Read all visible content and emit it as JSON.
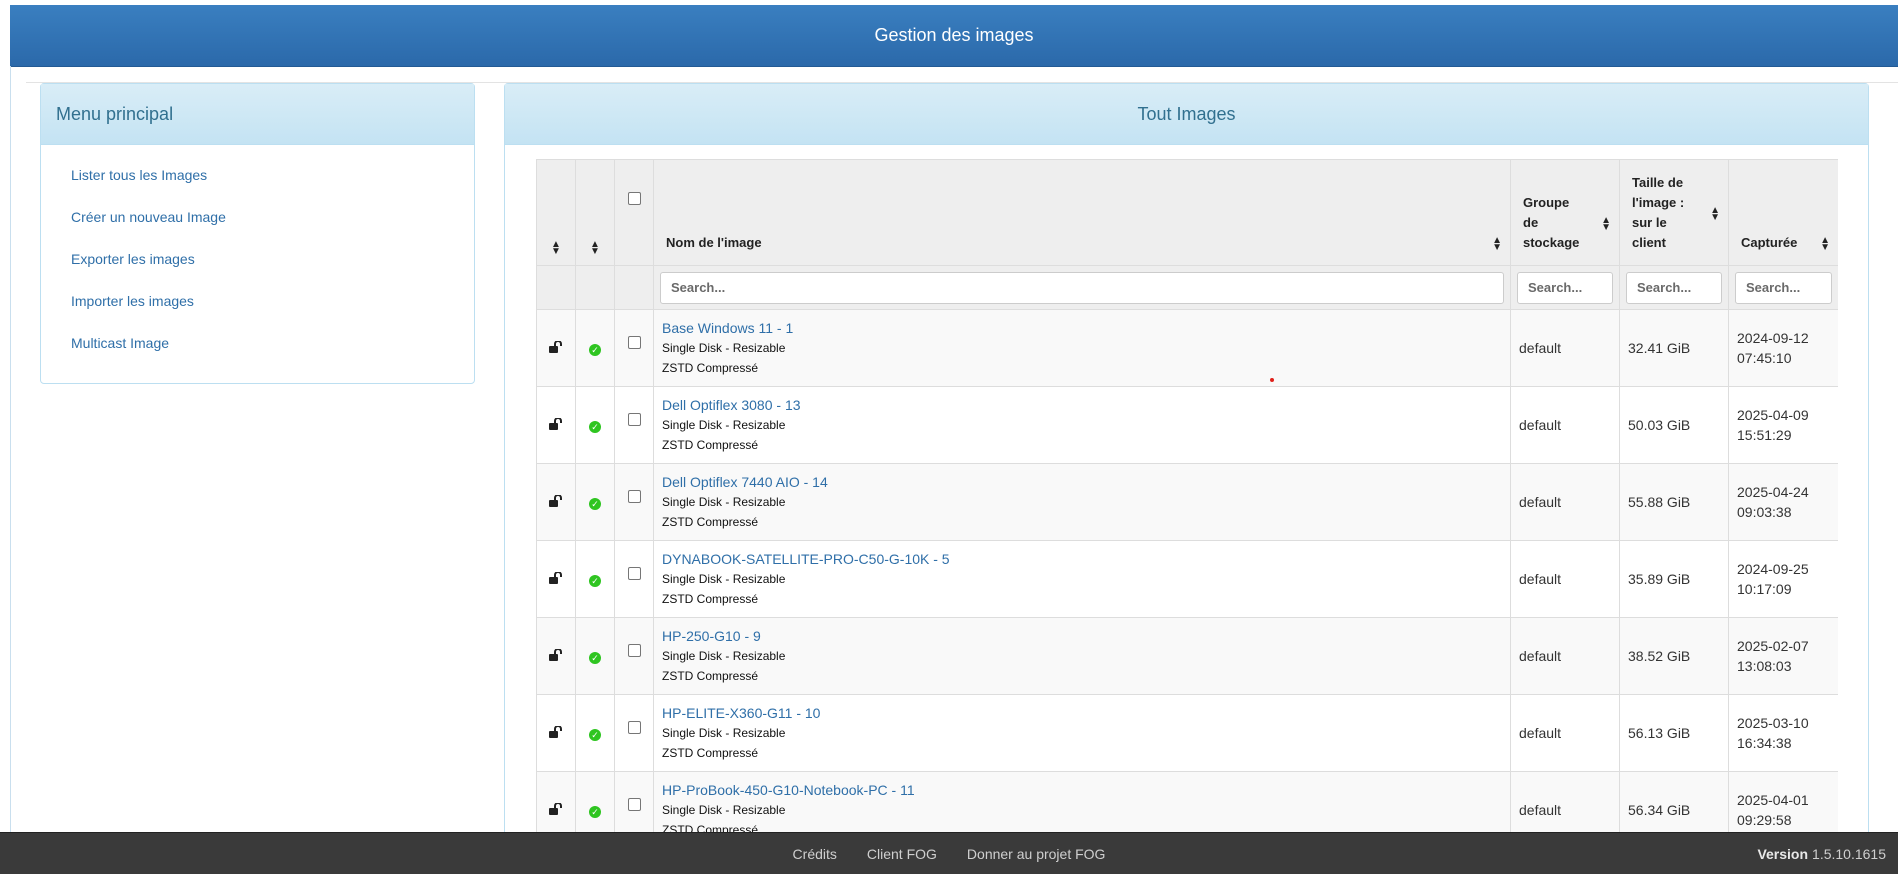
{
  "header": {
    "title": "Gestion des images"
  },
  "menu": {
    "title": "Menu principal",
    "items": [
      {
        "label": "Lister tous les Images"
      },
      {
        "label": "Créer un nouveau Image"
      },
      {
        "label": "Exporter les images"
      },
      {
        "label": "Importer les images"
      },
      {
        "label": "Multicast Image"
      }
    ]
  },
  "images_panel": {
    "title": "Tout Images",
    "columns": {
      "name": "Nom de l'image",
      "storage_group": [
        "Groupe",
        "de",
        "stockage"
      ],
      "size": [
        "Taille de",
        "l'image :",
        "sur le",
        "client"
      ],
      "captured": "Capturée"
    },
    "search_placeholder": "Search...",
    "rows": [
      {
        "name": "Base Windows 11 - 1",
        "type": "Single Disk - Resizable",
        "compression": "ZSTD Compressé",
        "storage_group": "default",
        "size": "32.41 GiB",
        "date": "2024-09-12",
        "time": "07:45:10"
      },
      {
        "name": "Dell Optiflex 3080 - 13",
        "type": "Single Disk - Resizable",
        "compression": "ZSTD Compressé",
        "storage_group": "default",
        "size": "50.03 GiB",
        "date": "2025-04-09",
        "time": "15:51:29"
      },
      {
        "name": "Dell Optiflex 7440 AIO - 14",
        "type": "Single Disk - Resizable",
        "compression": "ZSTD Compressé",
        "storage_group": "default",
        "size": "55.88 GiB",
        "date": "2025-04-24",
        "time": "09:03:38"
      },
      {
        "name": "DYNABOOK-SATELLITE-PRO-C50-G-10K - 5",
        "type": "Single Disk - Resizable",
        "compression": "ZSTD Compressé",
        "storage_group": "default",
        "size": "35.89 GiB",
        "date": "2024-09-25",
        "time": "10:17:09"
      },
      {
        "name": "HP-250-G10 - 9",
        "type": "Single Disk - Resizable",
        "compression": "ZSTD Compressé",
        "storage_group": "default",
        "size": "38.52 GiB",
        "date": "2025-02-07",
        "time": "13:08:03"
      },
      {
        "name": "HP-ELITE-X360-G11 - 10",
        "type": "Single Disk - Resizable",
        "compression": "ZSTD Compressé",
        "storage_group": "default",
        "size": "56.13 GiB",
        "date": "2025-03-10",
        "time": "16:34:38"
      },
      {
        "name": "HP-ProBook-450-G10-Notebook-PC - 11",
        "type": "Single Disk - Resizable",
        "compression": "ZSTD Compressé",
        "storage_group": "default",
        "size": "56.34 GiB",
        "date": "2025-04-01",
        "time": "09:29:58"
      }
    ]
  },
  "footer": {
    "links": [
      "Crédits",
      "Client FOG",
      "Donner au projet FOG"
    ],
    "version_label": "Version",
    "version": "1.5.10.1615"
  },
  "colors": {
    "header": "#2f70b0",
    "panel_head": "#d9edf7",
    "link": "#2f6fa8",
    "ok": "#2fc521",
    "footer": "#3a3a3a"
  }
}
